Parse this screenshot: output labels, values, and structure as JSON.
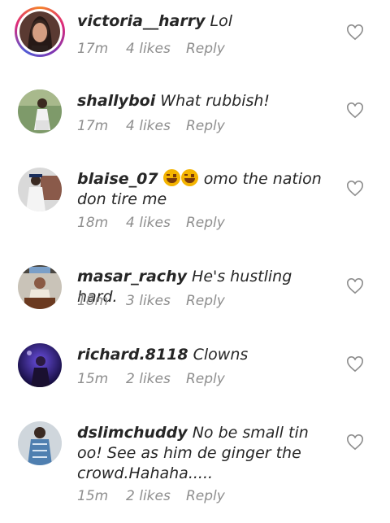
{
  "comments": [
    {
      "username": "victoria__harry",
      "text": "Lol",
      "time": "17m",
      "likes": "4 likes",
      "reply": "Reply"
    },
    {
      "username": "shallyboi",
      "text": "What rubbish!",
      "time": "17m",
      "likes": "4 likes",
      "reply": "Reply"
    },
    {
      "username": "blaise_07",
      "text": "omo the nation don tire me",
      "emoji": "grinning-face-with-sweat-emoji",
      "time": "18m",
      "likes": "4 likes",
      "reply": "Reply"
    },
    {
      "username": "masar_rachy",
      "text": "He's hustling hard.",
      "time": "18m",
      "likes": "3 likes",
      "reply": "Reply"
    },
    {
      "username": "richard.8118",
      "text": "Clowns",
      "time": "15m",
      "likes": "2 likes",
      "reply": "Reply"
    },
    {
      "username": "dslimchuddy",
      "text": "No be small tin oo! See as him de ginger the crowd.Hahaha.....",
      "time": "15m",
      "likes": "2 likes",
      "reply": "Reply"
    }
  ],
  "icons": {
    "like": "heart-outline-icon"
  },
  "colors": {
    "text": "#262626",
    "meta": "#8e8e8e",
    "story_ring": "#dd2a7b"
  }
}
